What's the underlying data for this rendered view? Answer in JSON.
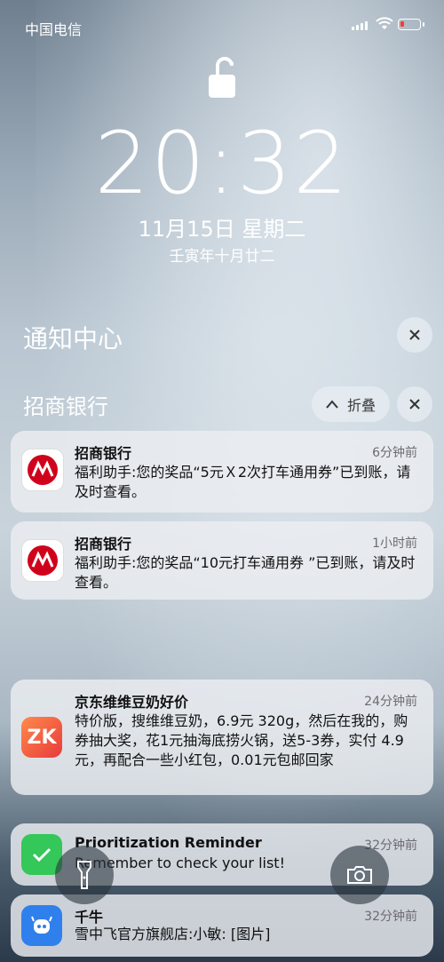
{
  "status": {
    "carrier": "中国电信"
  },
  "lockscreen": {
    "time": "20:32",
    "date": "11月15日 星期二",
    "lunar": "壬寅年十月廿二"
  },
  "notification_center": {
    "title": "通知中心"
  },
  "group": {
    "title": "招商银行",
    "fold_label": "折叠"
  },
  "notifications": [
    {
      "app": "招商银行",
      "time": "6分钟前",
      "body": "福利助手:您的奖品“5元Ｘ2次打车通用券”已到账，请及时查看。",
      "icon": "cmb-logo"
    },
    {
      "app": "招商银行",
      "time": "1小时前",
      "body": "福利助手:您的奖品“10元打车通用券 ”已到账，请及时查看。",
      "icon": "cmb-logo"
    },
    {
      "app": "京东维维豆奶好价",
      "time": "24分钟前",
      "body": "特价版，搜维维豆奶，6.9元 320g，然后在我的，购券抽大奖，花1元抽海底捞火锅，送5-3券，实付 4.9元，再配合一些小红包，0.01元包邮回家",
      "icon": "zk-logo",
      "icon_text": "ZK"
    },
    {
      "app": "Prioritization Reminder",
      "time": "32分钟前",
      "body": "Remember to check your list!",
      "icon": "checkmark-icon"
    },
    {
      "app": "千牛",
      "time": "32分钟前",
      "body": "雪中飞官方旗舰店:小敏: [图片]",
      "icon": "qianniu-icon"
    }
  ],
  "colors": {
    "zk_gradient": [
      "#ff8a4c",
      "#e83b3b"
    ],
    "check_green": "#34c759",
    "qianniu_blue": "#2f80ed",
    "cmb_red": "#d0021b"
  }
}
